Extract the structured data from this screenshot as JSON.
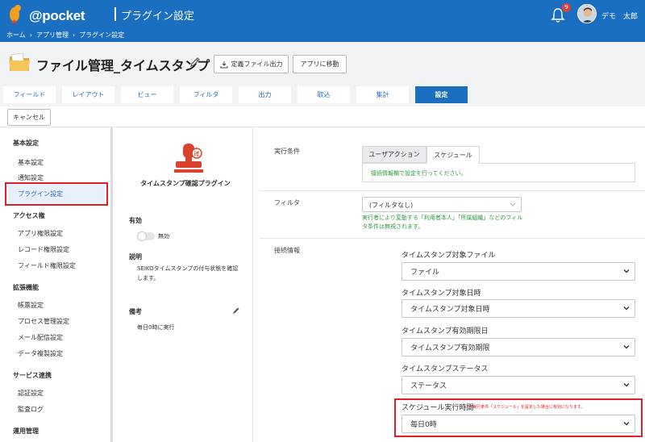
{
  "app": {
    "logo_text": "@pocket",
    "title": "プラグイン設定",
    "notification_count": "9",
    "user_name": "デモ　太郎"
  },
  "breadcrumb": [
    "ホーム",
    "アプリ管理",
    "プラグイン設定"
  ],
  "header": {
    "title": "ファイル管理_タイムスタンプ",
    "export_label": "定義ファイル出力",
    "goto_app_label": "アプリに移動"
  },
  "tabs": [
    "フィールド",
    "レイアウト",
    "ビュー",
    "フィルタ",
    "出力",
    "取込",
    "集計",
    "設定"
  ],
  "cancel_label": "キャンセル",
  "sidebar": {
    "basic": {
      "head": "基本設定",
      "items": [
        "基本設定",
        "通知設定",
        "プラグイン設定"
      ]
    },
    "access": {
      "head": "アクセス権",
      "items": [
        "アプリ権限設定",
        "レコード権限設定",
        "フィールド権限設定"
      ]
    },
    "ext": {
      "head": "拡張機能",
      "items": [
        "帳票設定",
        "プロセス管理設定",
        "メール配信設定",
        "データ複製設定"
      ]
    },
    "service": {
      "head": "サービス連携",
      "items": [
        "認証設定",
        "監査ログ"
      ]
    },
    "ops": {
      "head": "運用管理"
    }
  },
  "plugin": {
    "name": "タイムスタンプ確認プラグイン",
    "enabled_label": "有効",
    "toggle_label": "無効",
    "desc_label": "説明",
    "desc": "SEIKOタイムスタンプの付与状態を確認します。",
    "note_label": "備考",
    "note": "毎日0時に実行"
  },
  "main": {
    "exec_cond_label": "実行条件",
    "exec_tabs": [
      "ユーザアクション",
      "スケジュール"
    ],
    "exec_info": "接続情報欄で設定を行ってください。",
    "filter_label": "フィルタ",
    "filter_value": "(フィルタなし)",
    "filter_note": "実行者により変動する「利用者本人」「所属組織」などのフィルタ条件は無視されます。",
    "conn_label": "接続情報",
    "fields": [
      {
        "label": "タイムスタンプ対象ファイル",
        "value": "ファイル"
      },
      {
        "label": "タイムスタンプ対象日時",
        "value": "タイムスタンプ対象日時"
      },
      {
        "label": "タイムスタンプ有効期限日",
        "value": "タイムスタンプ有効期限"
      },
      {
        "label": "タイムスタンプステータス",
        "value": "ステータス"
      }
    ],
    "schedule": {
      "label": "スケジュール実行時間",
      "note": "※実行条件「スケジュール」を設定した場合に有効になります。",
      "value": "毎日0時"
    }
  },
  "colors": {
    "brand": "#1a6fc0",
    "highlight": "#e01f26",
    "link": "#2d6cc0",
    "note_green": "#2e9a3f"
  }
}
